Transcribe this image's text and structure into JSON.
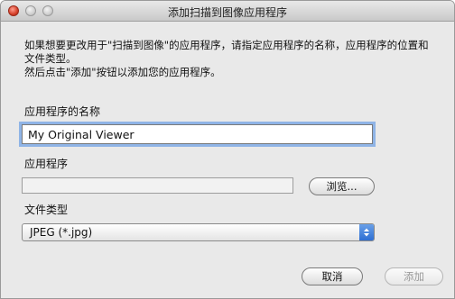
{
  "window": {
    "title": "添加扫描到图像应用程序"
  },
  "description": {
    "line1": "如果想要更改用于\"扫描到图像\"的应用程序，请指定应用程序的名称，应用程序的位置和文件类型。",
    "line2": "然后点击\"添加\"按钮以添加您的应用程序。"
  },
  "app_name": {
    "label": "应用程序的名称",
    "value": "My Original Viewer"
  },
  "app_path": {
    "label": "应用程序",
    "value": "",
    "browse_label": "浏览..."
  },
  "file_type": {
    "label": "文件类型",
    "selected": "JPEG (*.jpg)"
  },
  "buttons": {
    "cancel": "取消",
    "add": "添加"
  }
}
